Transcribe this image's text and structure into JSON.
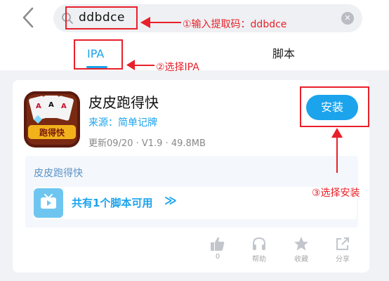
{
  "search": {
    "value": "ddbdce",
    "clear_symbol": "✕"
  },
  "tabs": [
    {
      "label": "IPA"
    },
    {
      "label": "脚本"
    }
  ],
  "app": {
    "name": "皮皮跑得快",
    "source": "来源：简单记牌",
    "meta": "更新09/20 · V1.9 · 49.8MB",
    "icon_text": "跑得快",
    "install_label": "安装"
  },
  "scripts": {
    "title": "皮皮跑得快",
    "available_text": "共有1个脚本可用",
    "arrow": "≫"
  },
  "actions": [
    {
      "icon": "thumbs-up-icon",
      "label": "0"
    },
    {
      "icon": "headphones-icon",
      "label": "帮助"
    },
    {
      "icon": "star-icon",
      "label": "收藏"
    },
    {
      "icon": "share-icon",
      "label": "分享"
    }
  ],
  "annotations": {
    "step1": "①输入提取码：ddbdce",
    "step2": "②选择IPA",
    "step3": "③选择安装"
  },
  "colors": {
    "accent": "#1ba3ec",
    "annotation": "#e8202a"
  }
}
